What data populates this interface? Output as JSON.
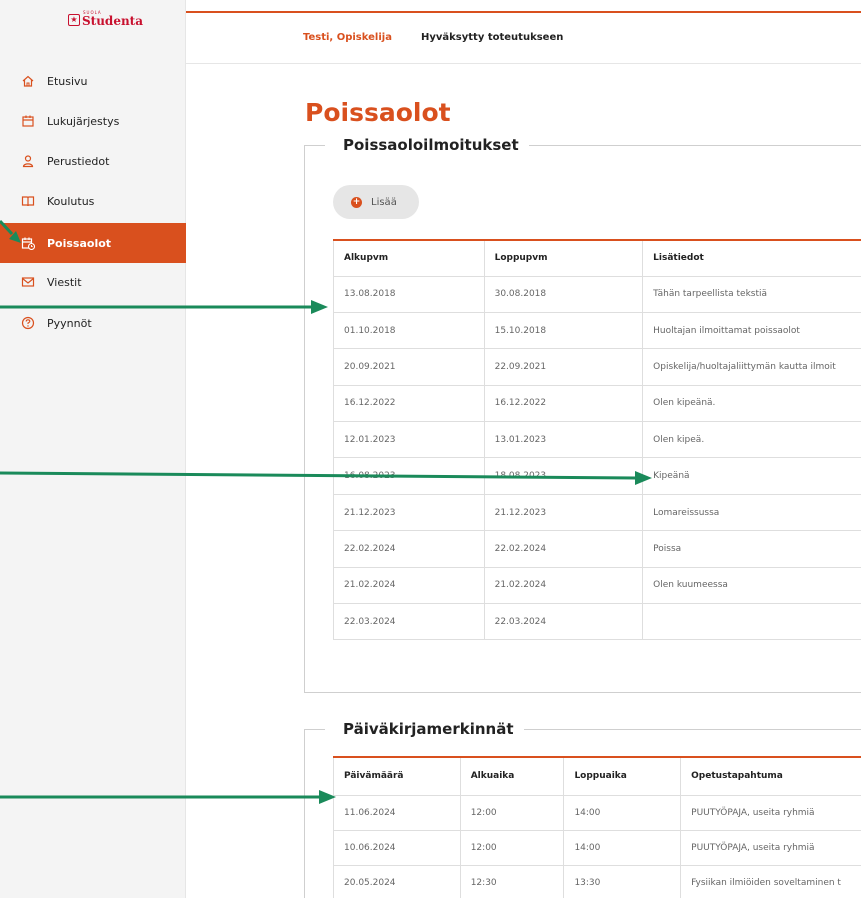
{
  "app": {
    "logo_small": "SUOLA",
    "logo_word": "Studenta"
  },
  "sidebar": {
    "items": [
      {
        "label": "Etusivu",
        "icon": "home-icon"
      },
      {
        "label": "Lukujärjestys",
        "icon": "calendar-icon"
      },
      {
        "label": "Perustiedot",
        "icon": "user-icon"
      },
      {
        "label": "Koulutus",
        "icon": "book-icon"
      },
      {
        "label": "Poissaolot",
        "icon": "calendar-clock-icon",
        "active": true
      },
      {
        "label": "Viestit",
        "icon": "mail-icon"
      },
      {
        "label": "Pyynnöt",
        "icon": "question-icon"
      }
    ]
  },
  "header": {
    "student": "Testi, Opiskelija",
    "status": "Hyväksytty toteutukseen"
  },
  "page": {
    "title": "Poissaolot"
  },
  "absences": {
    "legend": "Poissaoloilmoitukset",
    "add_label": "Lisää",
    "columns": [
      "Alkupvm",
      "Loppupvm",
      "Lisätiedot"
    ],
    "rows": [
      [
        "13.08.2018",
        "30.08.2018",
        "Tähän tarpeellista tekstiä"
      ],
      [
        "01.10.2018",
        "15.10.2018",
        "Huoltajan ilmoittamat poissaolot"
      ],
      [
        "20.09.2021",
        "22.09.2021",
        "Opiskelija/huoltajaliittymän kautta ilmoit"
      ],
      [
        "16.12.2022",
        "16.12.2022",
        "Olen kipeänä."
      ],
      [
        "12.01.2023",
        "13.01.2023",
        "Olen kipeä."
      ],
      [
        "16.08.2023",
        "18.08.2023",
        "Kipeänä"
      ],
      [
        "21.12.2023",
        "21.12.2023",
        "Lomareissussa"
      ],
      [
        "22.02.2024",
        "22.02.2024",
        "Poissa"
      ],
      [
        "21.02.2024",
        "21.02.2024",
        "Olen kuumeessa"
      ],
      [
        "22.03.2024",
        "22.03.2024",
        ""
      ]
    ]
  },
  "diary": {
    "legend": "Päiväkirjamerkinnät",
    "columns": [
      "Päivämäärä",
      "Alkuaika",
      "Loppuaika",
      "Opetustapahtuma"
    ],
    "rows": [
      [
        "11.06.2024",
        "12:00",
        "14:00",
        "PUUTYÖPAJA, useita ryhmiä"
      ],
      [
        "10.06.2024",
        "12:00",
        "14:00",
        "PUUTYÖPAJA, useita ryhmiä"
      ],
      [
        "20.05.2024",
        "12:30",
        "13:30",
        "Fysiikan ilmiöiden soveltaminen t"
      ]
    ]
  },
  "colors": {
    "accent": "#d9501e",
    "arrow": "#1a8a5a",
    "logo": "#c8102e"
  }
}
